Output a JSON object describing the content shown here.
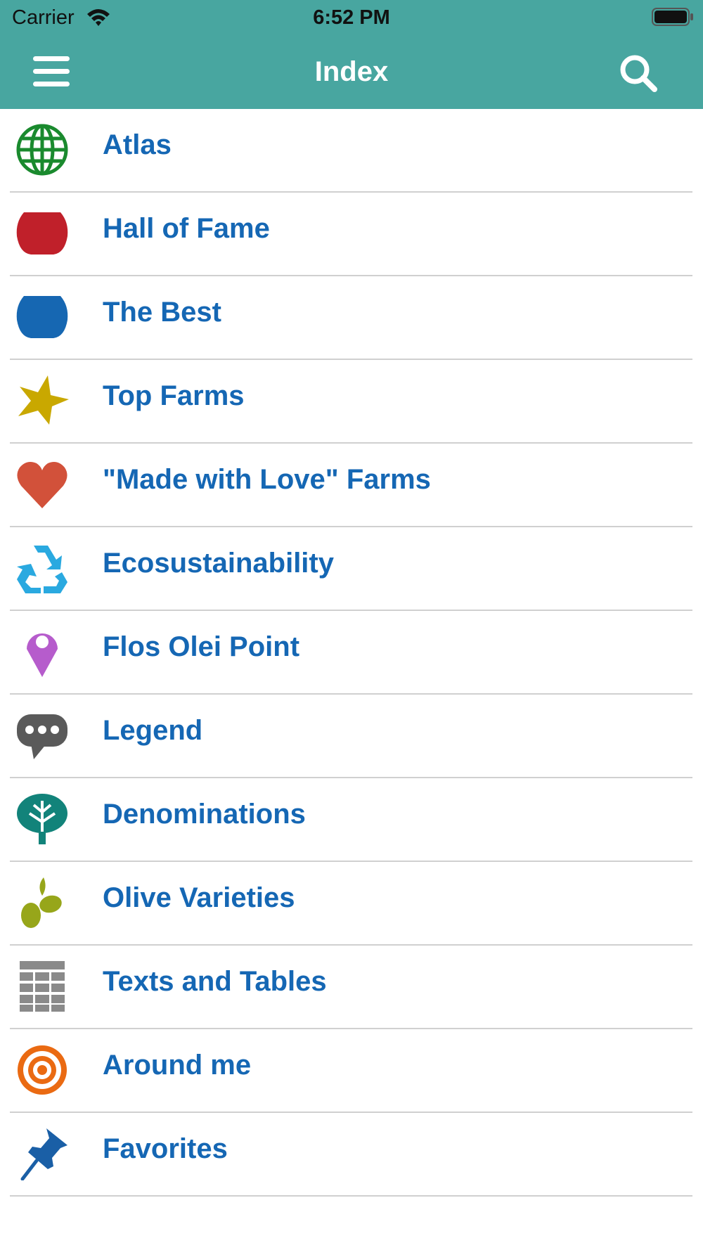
{
  "status_bar": {
    "carrier": "Carrier",
    "time": "6:52 PM"
  },
  "nav": {
    "title": "Index",
    "menu_icon": "hamburger-menu-icon",
    "search_icon": "search-icon"
  },
  "colors": {
    "header_bg": "#48a6a0",
    "item_text": "#1567b4",
    "divider": "#d0d0d0"
  },
  "items": [
    {
      "label": "Atlas",
      "icon": "globe-icon",
      "color": "#1a8a2e"
    },
    {
      "label": "Hall of Fame",
      "icon": "red-gem-icon",
      "color": "#c0202a"
    },
    {
      "label": "The Best",
      "icon": "blue-gem-icon",
      "color": "#1667b2"
    },
    {
      "label": "Top Farms",
      "icon": "star-icon",
      "color": "#c9a800"
    },
    {
      "label": "\"Made with Love\" Farms",
      "icon": "heart-icon",
      "color": "#d2513a"
    },
    {
      "label": "Ecosustainability",
      "icon": "recycle-icon",
      "color": "#2aa9e0"
    },
    {
      "label": "Flos Olei Point",
      "icon": "map-pin-icon",
      "color": "#b65ccc"
    },
    {
      "label": "Legend",
      "icon": "speech-bubble-icon",
      "color": "#5a5a5a"
    },
    {
      "label": "Denominations",
      "icon": "tree-icon",
      "color": "#12837a"
    },
    {
      "label": "Olive Varieties",
      "icon": "olive-icon",
      "color": "#97a61a"
    },
    {
      "label": "Texts and Tables",
      "icon": "table-grid-icon",
      "color": "#8a8a8a"
    },
    {
      "label": "Around me",
      "icon": "target-icon",
      "color": "#ea6a12"
    },
    {
      "label": "Favorites",
      "icon": "pushpin-icon",
      "color": "#1a5fa6"
    }
  ]
}
